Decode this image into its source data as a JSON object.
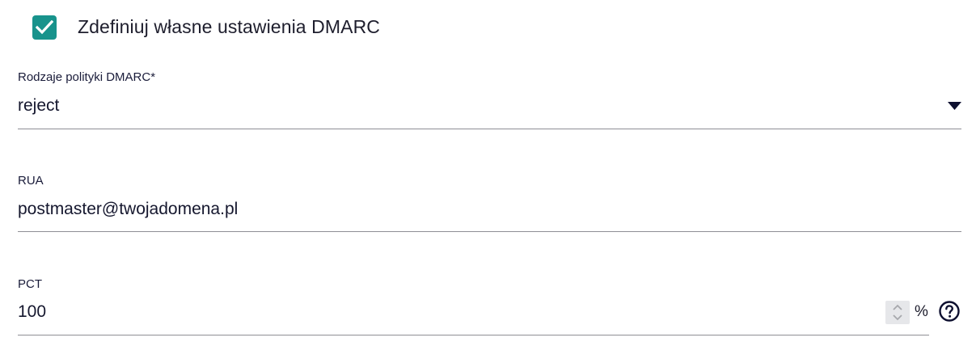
{
  "checkbox": {
    "label": "Zdefiniuj własne ustawienia DMARC",
    "checked": true,
    "color": "#18938c",
    "icon": "checkmark-icon"
  },
  "policy": {
    "label": "Rodzaje polityki DMARC*",
    "value": "reject",
    "icon": "dropdown-arrow-icon"
  },
  "rua": {
    "label": "RUA",
    "value": "postmaster@twojadomena.pl"
  },
  "pct": {
    "label": "PCT",
    "value": "100",
    "unit": "%",
    "spinner_icon": "spinner-icon",
    "help_icon": "help-icon"
  }
}
